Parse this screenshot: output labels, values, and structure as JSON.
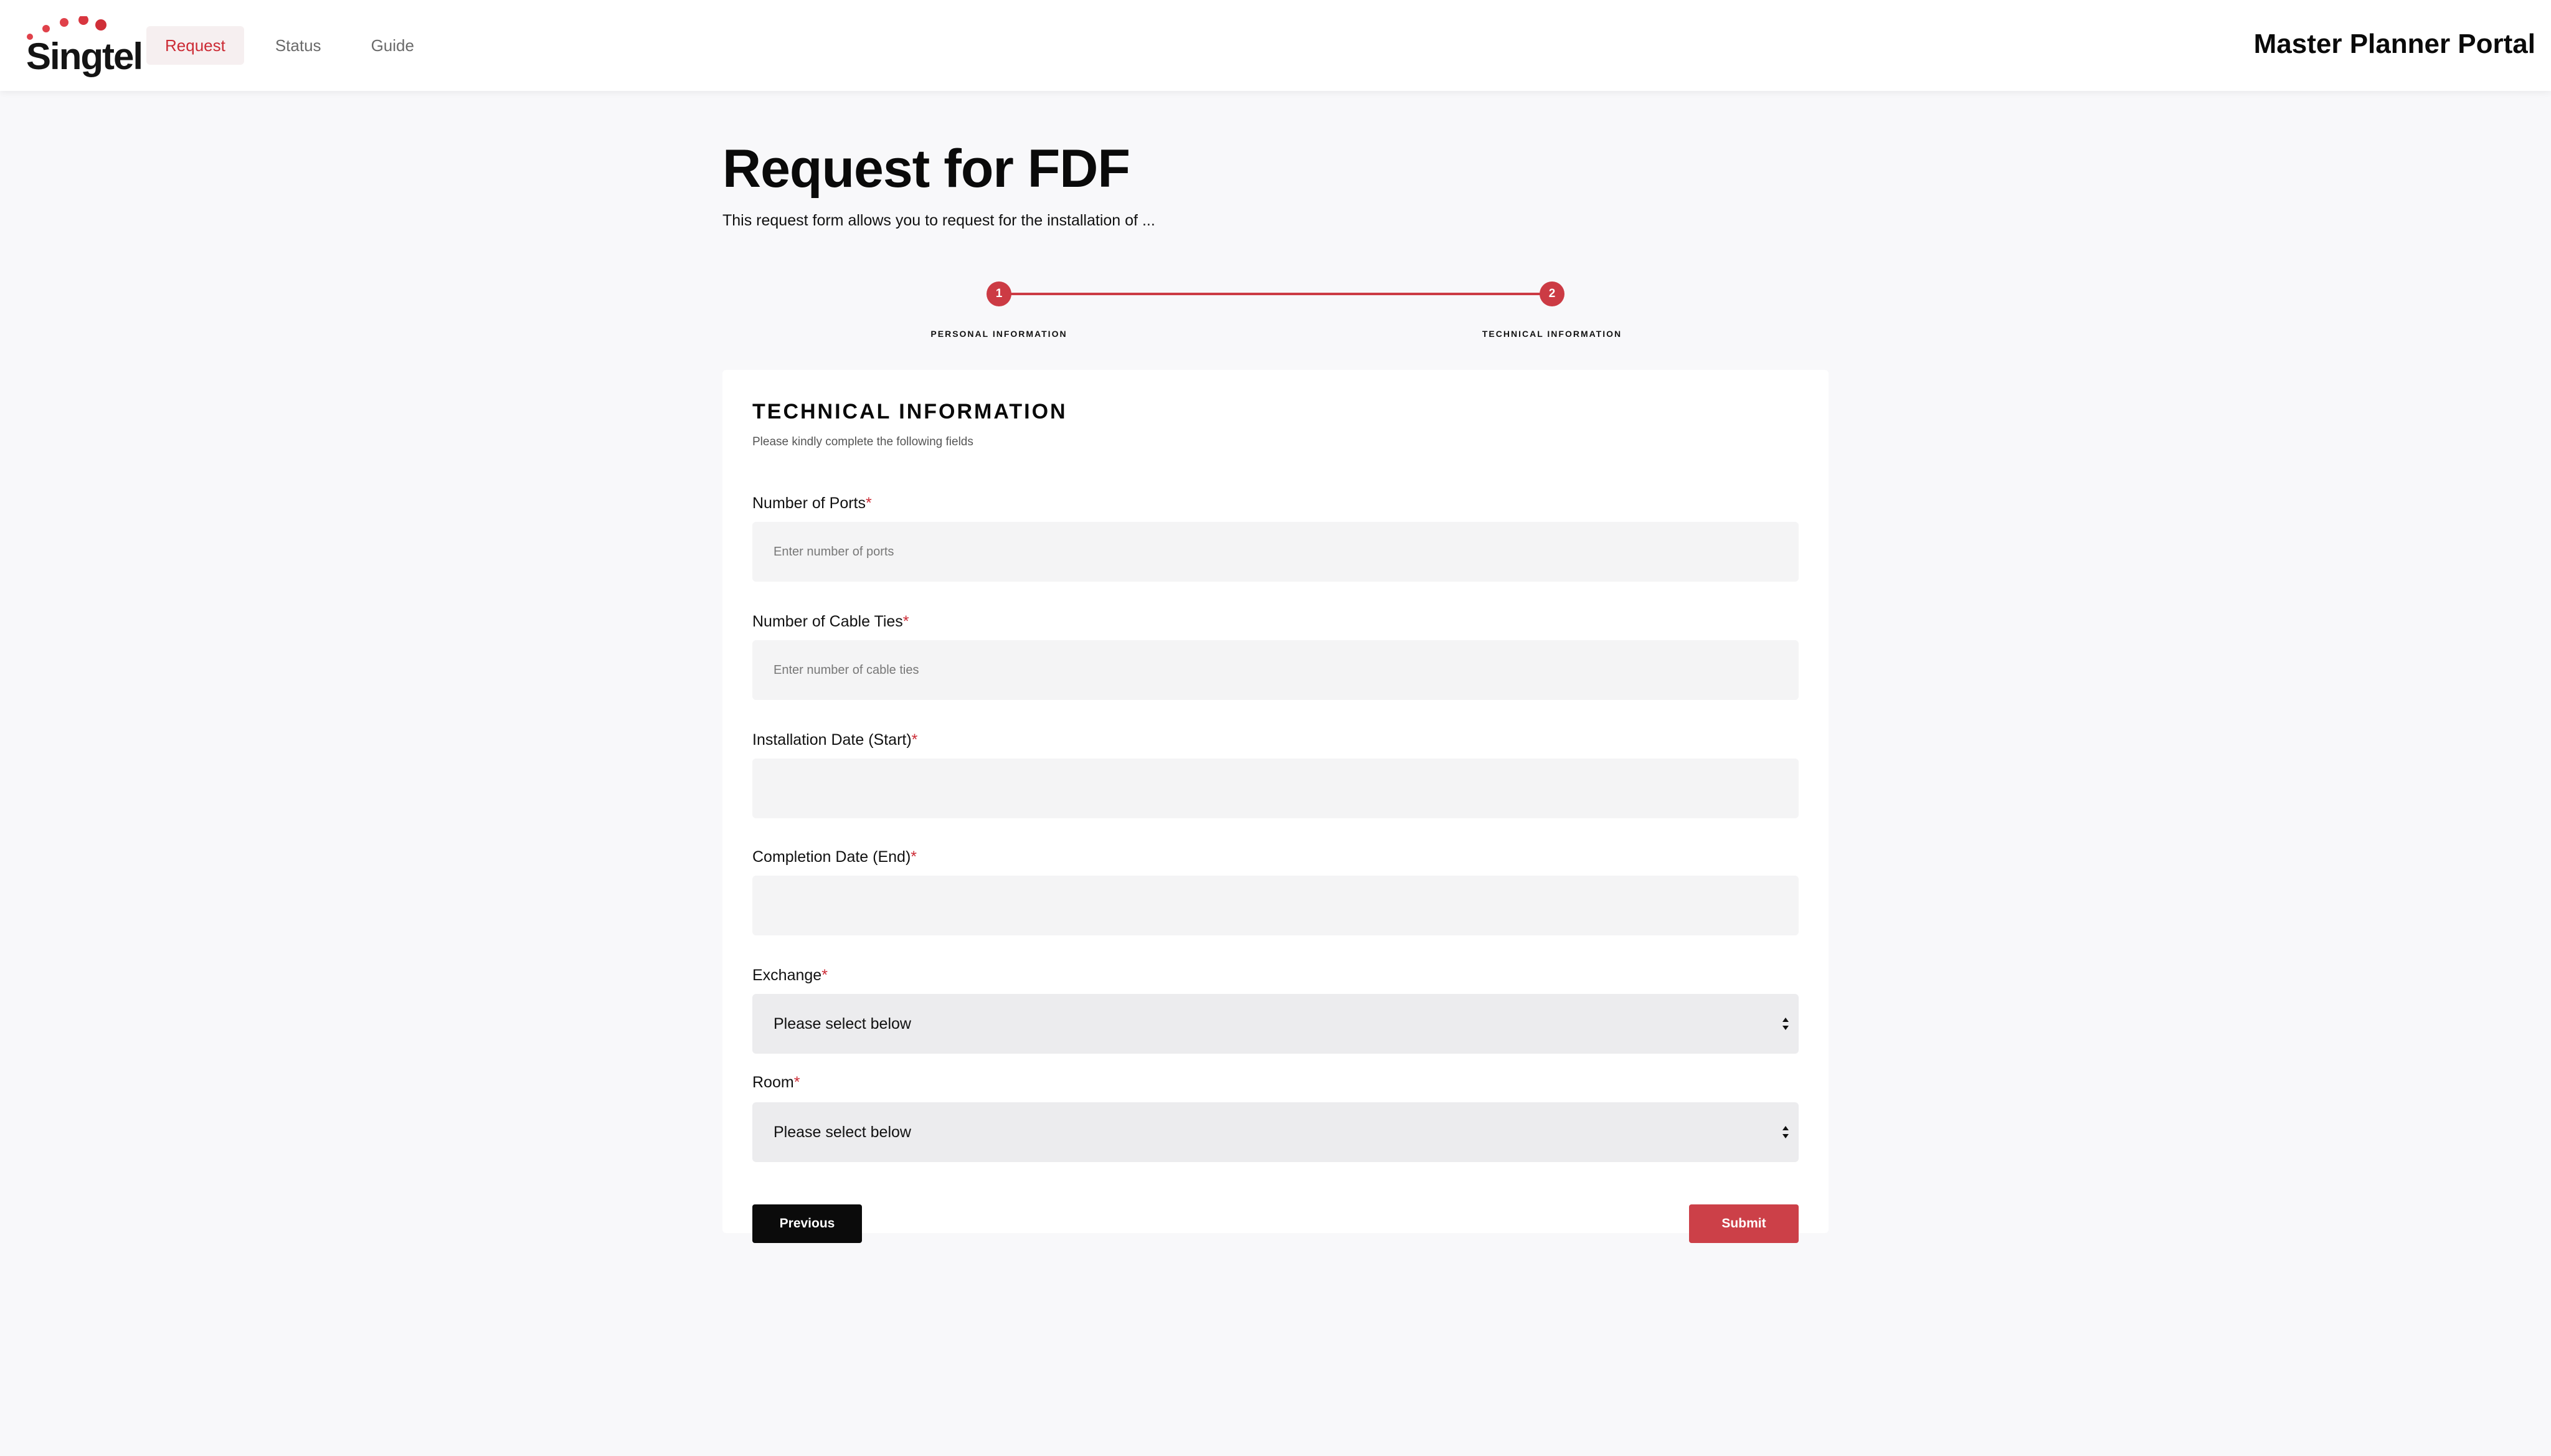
{
  "brand": {
    "logo_text": "Singtel",
    "accent_color": "#cc2b35"
  },
  "nav": {
    "items": [
      {
        "label": "Request",
        "active": true
      },
      {
        "label": "Status",
        "active": false
      },
      {
        "label": "Guide",
        "active": false
      }
    ]
  },
  "portal_title": "Master Planner Portal",
  "page": {
    "title": "Request for FDF",
    "description": "This request form allows you to request for the installation of ..."
  },
  "stepper": {
    "steps": [
      {
        "number": "1",
        "label": "PERSONAL INFORMATION"
      },
      {
        "number": "2",
        "label": "TECHNICAL INFORMATION"
      }
    ]
  },
  "form": {
    "section_title": "TECHNICAL INFORMATION",
    "section_subtitle": "Please kindly complete the following fields",
    "required_marker": "*",
    "fields": {
      "ports": {
        "label": "Number of Ports",
        "placeholder": "Enter number of ports",
        "value": ""
      },
      "cable_ties": {
        "label": "Number of Cable Ties",
        "placeholder": "Enter number of cable ties",
        "value": ""
      },
      "start_date": {
        "label": "Installation Date (Start)",
        "value": ""
      },
      "end_date": {
        "label": "Completion Date (End)",
        "value": ""
      },
      "exchange": {
        "label": "Exchange",
        "selected": "Please select below"
      },
      "room": {
        "label": "Room",
        "selected": "Please select below"
      }
    },
    "buttons": {
      "previous": "Previous",
      "submit": "Submit"
    }
  }
}
